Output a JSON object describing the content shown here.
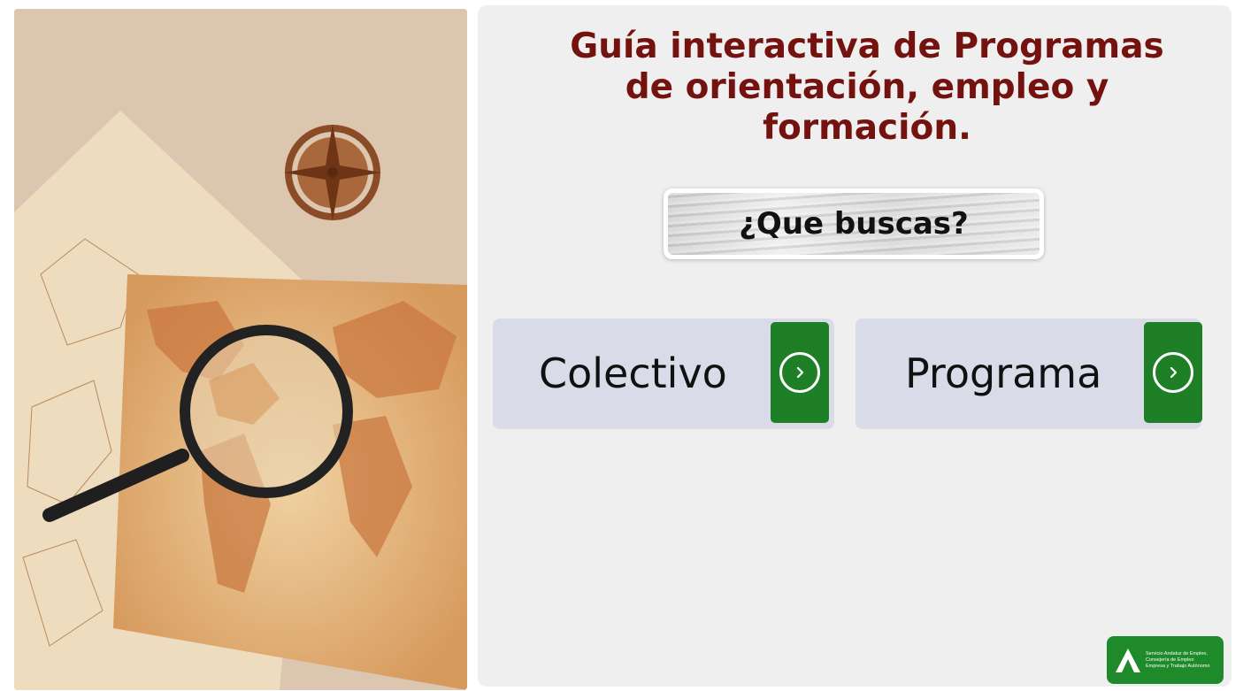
{
  "header": {
    "title": "Guía interactiva de Programas de orientación, empleo y formación."
  },
  "question": {
    "label": "¿Que buscas?"
  },
  "choices": [
    {
      "label": "Colectivo",
      "icon": "chevron-right-circle-icon"
    },
    {
      "label": "Programa",
      "icon": "chevron-right-circle-icon"
    }
  ],
  "logo": {
    "lines": [
      "Servicio Andaluz de Empleo,",
      "Consejería de Empleo",
      "Empresa y Trabajo Autónomo"
    ]
  },
  "colors": {
    "title": "#74120f",
    "panel": "#efefef",
    "choice_bg": "#d9dce8",
    "button": "#1f7f27",
    "logo_bg": "#1e8a2a"
  }
}
